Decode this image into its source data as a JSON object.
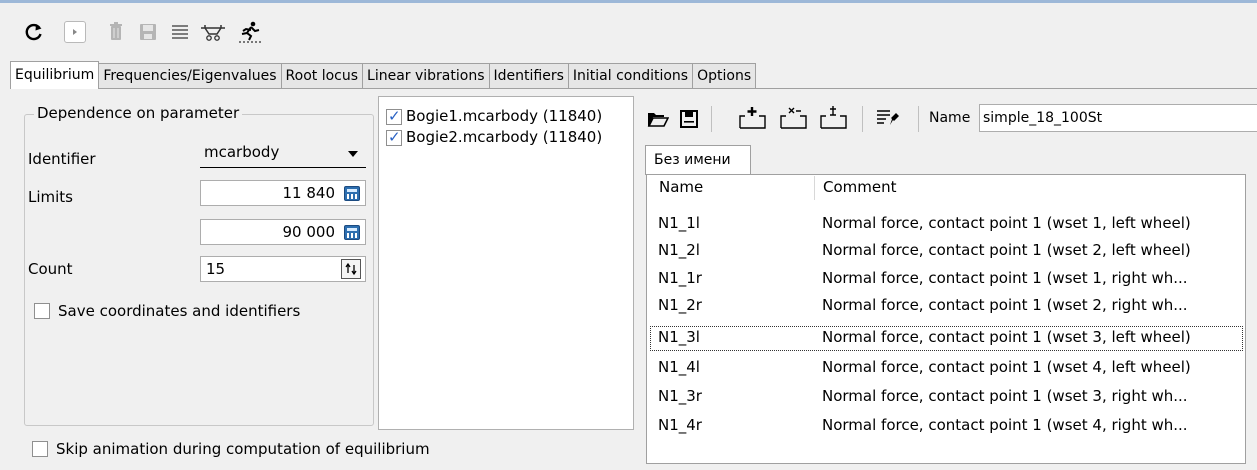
{
  "toolbar": {
    "icons": [
      "refresh-icon",
      "play-icon",
      "trash-icon",
      "save-icon",
      "list-icon",
      "vehicle-icon",
      "run-icon"
    ]
  },
  "tabs": [
    {
      "label": "Equilibrium",
      "active": true
    },
    {
      "label": "Frequencies/Eigenvalues"
    },
    {
      "label": "Root locus"
    },
    {
      "label": "Linear vibrations"
    },
    {
      "label": "Identifiers"
    },
    {
      "label": "Initial conditions"
    },
    {
      "label": "Options"
    }
  ],
  "dependence": {
    "title": "Dependence on parameter",
    "identifier_label": "Identifier",
    "identifier_value": "mcarbody",
    "limits_label": "Limits",
    "limit_min": "11 840",
    "limit_max": "90 000",
    "count_label": "Count",
    "count_value": "15",
    "save_label": "Save coordinates and identifiers"
  },
  "skip_animation_label": "Skip animation during computation of equilibrium",
  "identifier_list": [
    {
      "label": "Bogie1.mcarbody (11840)",
      "checked": true
    },
    {
      "label": "Bogie2.mcarbody (11840)",
      "checked": true
    }
  ],
  "right": {
    "name_label": "Name",
    "name_value": "simple_18_100St",
    "subtab": "Без имени",
    "columns": [
      "Name",
      "Comment"
    ],
    "rows": [
      {
        "name": "N1_1l",
        "comment": "Normal force, contact point 1 (wset 1, left wheel)"
      },
      {
        "name": "N1_2l",
        "comment": "Normal force, contact point 1 (wset 2, left wheel)"
      },
      {
        "name": "N1_1r",
        "comment": "Normal force, contact point 1 (wset 1, right wh..."
      },
      {
        "name": "N1_2r",
        "comment": "Normal force, contact point 1 (wset 2, right wh..."
      },
      {
        "name": "N1_3l",
        "comment": "Normal force, contact point 1 (wset 3, left wheel)"
      },
      {
        "name": "N1_4l",
        "comment": "Normal force, contact point 1 (wset 4, left wheel)"
      },
      {
        "name": "N1_3r",
        "comment": "Normal force, contact point 1 (wset 3, right wh..."
      },
      {
        "name": "N1_4r",
        "comment": "Normal force, contact point 1 (wset 4, right wh..."
      }
    ],
    "focused_row": 4
  }
}
